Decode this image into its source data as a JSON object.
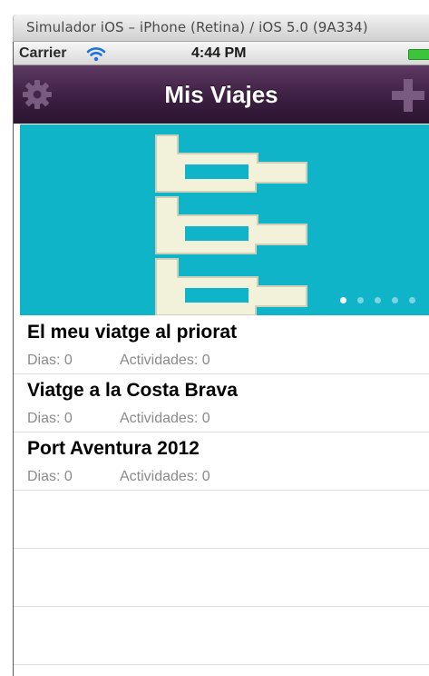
{
  "window": {
    "title": "Simulador iOS – iPhone (Retina) / iOS 5.0 (9A334)"
  },
  "status_bar": {
    "carrier": "Carrier",
    "time": "4:44 PM"
  },
  "nav_bar": {
    "title": "Mis Viajes",
    "left_icon": "gear-icon",
    "right_icon": "plus-icon"
  },
  "banner": {
    "page_count": 5,
    "active_page": 0
  },
  "trips": [
    {
      "name": "El meu viatge al priorat",
      "days": "Dias: 0",
      "activities": "Actividades: 0"
    },
    {
      "name": "Viatge a la Costa Brava",
      "days": "Dias: 0",
      "activities": "Actividades: 0"
    },
    {
      "name": "Port Aventura 2012",
      "days": "Dias: 0",
      "activities": "Actividades: 0"
    }
  ],
  "colors": {
    "nav_bar": "#3c1f42",
    "banner": "#10b4c8",
    "battery": "#3cc43c"
  }
}
